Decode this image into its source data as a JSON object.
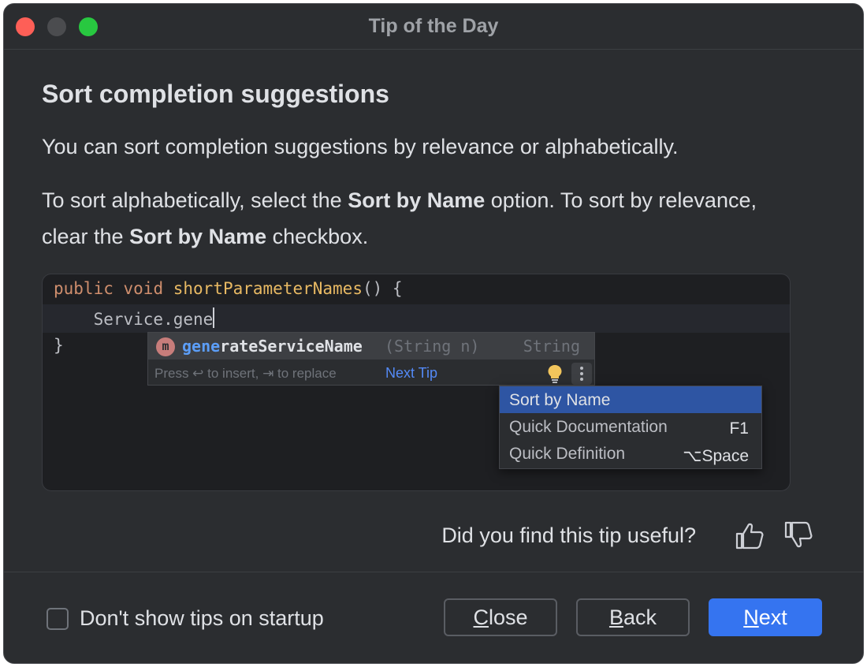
{
  "window": {
    "title": "Tip of the Day"
  },
  "tip": {
    "heading": "Sort completion suggestions",
    "paragraph1": "You can sort completion suggestions by relevance or alphabetically.",
    "paragraph2": {
      "p1": "To sort alphabetically, select the ",
      "b1": "Sort by Name",
      "p2": " option. To sort by relevance, clear the ",
      "b2": "Sort by Name",
      "p3": " checkbox."
    }
  },
  "code": {
    "line1": {
      "kw1": "public",
      "kw2": "void",
      "fn": "shortParameterNames",
      "rest": "() {"
    },
    "line2": "Service.gene",
    "line3": "}"
  },
  "completion": {
    "icon_letter": "m",
    "name_match": "gene",
    "name_rest": "rateServiceName",
    "params": "(String n)",
    "return_type": "String",
    "hint": "Press ↩ to insert, ⇥ to replace",
    "next_tip": "Next Tip"
  },
  "menu": {
    "items": [
      {
        "label": "Sort by Name",
        "shortcut": ""
      },
      {
        "label": "Quick Documentation",
        "shortcut": "F1"
      },
      {
        "label": "Quick Definition",
        "shortcut": "⌥Space"
      }
    ]
  },
  "feedback": {
    "question": "Did you find this tip useful?"
  },
  "footer": {
    "checkbox_label": "Don't show tips on startup",
    "checkbox_checked": false,
    "close": {
      "first": "C",
      "rest": "lose"
    },
    "back": {
      "first": "B",
      "rest": "ack"
    },
    "next": {
      "first": "N",
      "rest": "ext"
    }
  },
  "colors": {
    "background": "#2b2d30",
    "accent": "#3574f0",
    "selection": "#2e55a3",
    "keyword": "#cf8e6d",
    "function": "#e8b963"
  }
}
